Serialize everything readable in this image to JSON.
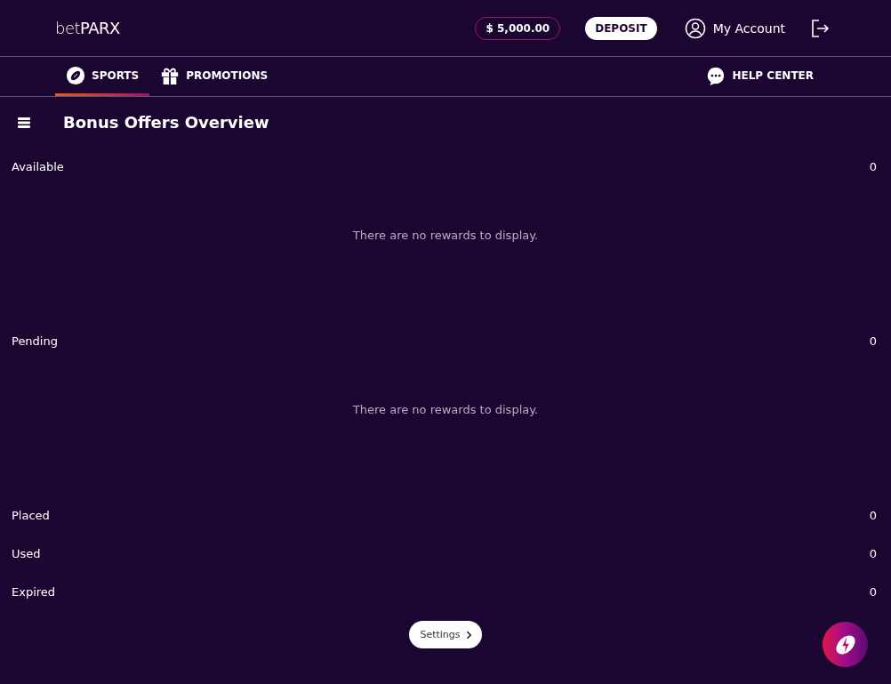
{
  "header": {
    "logo": "bet**PARX**",
    "balance": "$ 5,000.00",
    "deposit": "DEPOSIT",
    "account": "My Account"
  },
  "nav": {
    "tabs": [
      {
        "label": "SPORTS",
        "selected": true
      },
      {
        "label": "PROMOTIONS",
        "selected": false
      }
    ],
    "help": "HELP CENTER"
  },
  "page": {
    "title": "Bonus Offers Overview"
  },
  "sections": [
    {
      "label": "Available",
      "count": "0",
      "empty_message": "There are no rewards to display."
    },
    {
      "label": "Pending",
      "count": "0",
      "empty_message": "There are no rewards to display."
    },
    {
      "label": "Placed",
      "count": "0"
    },
    {
      "label": "Used",
      "count": "0"
    },
    {
      "label": "Expired",
      "count": "0"
    }
  ],
  "settings": "Settings"
}
